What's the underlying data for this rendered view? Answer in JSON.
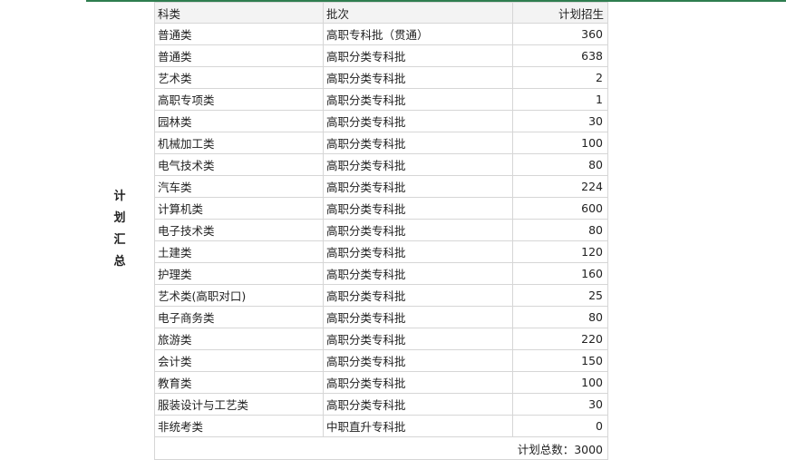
{
  "side_label": [
    "计",
    "划",
    "汇",
    "总"
  ],
  "headers": {
    "category": "科类",
    "batch": "批次",
    "plan": "计划招生"
  },
  "rows": [
    {
      "category": "普通类",
      "batch": "高职专科批（贯通）",
      "plan": "360"
    },
    {
      "category": "普通类",
      "batch": "高职分类专科批",
      "plan": "638"
    },
    {
      "category": "艺术类",
      "batch": "高职分类专科批",
      "plan": "2"
    },
    {
      "category": "高职专项类",
      "batch": "高职分类专科批",
      "plan": "1"
    },
    {
      "category": "园林类",
      "batch": "高职分类专科批",
      "plan": "30"
    },
    {
      "category": "机械加工类",
      "batch": "高职分类专科批",
      "plan": "100"
    },
    {
      "category": "电气技术类",
      "batch": "高职分类专科批",
      "plan": "80"
    },
    {
      "category": "汽车类",
      "batch": "高职分类专科批",
      "plan": "224"
    },
    {
      "category": "计算机类",
      "batch": "高职分类专科批",
      "plan": "600"
    },
    {
      "category": "电子技术类",
      "batch": "高职分类专科批",
      "plan": "80"
    },
    {
      "category": "土建类",
      "batch": "高职分类专科批",
      "plan": "120"
    },
    {
      "category": "护理类",
      "batch": "高职分类专科批",
      "plan": "160"
    },
    {
      "category": "艺术类(高职对口)",
      "batch": "高职分类专科批",
      "plan": "25"
    },
    {
      "category": "电子商务类",
      "batch": "高职分类专科批",
      "plan": "80"
    },
    {
      "category": "旅游类",
      "batch": "高职分类专科批",
      "plan": "220"
    },
    {
      "category": "会计类",
      "batch": "高职分类专科批",
      "plan": "150"
    },
    {
      "category": "教育类",
      "batch": "高职分类专科批",
      "plan": "100"
    },
    {
      "category": "服装设计与工艺类",
      "batch": "高职分类专科批",
      "plan": "30"
    },
    {
      "category": "非统考类",
      "batch": "中职直升专科批",
      "plan": "0"
    }
  ],
  "total": "计划总数：3000",
  "colors": {
    "top_rule": "#2e7d4f",
    "border": "#d6d6d6",
    "header_bg": "#f3f3f3"
  }
}
